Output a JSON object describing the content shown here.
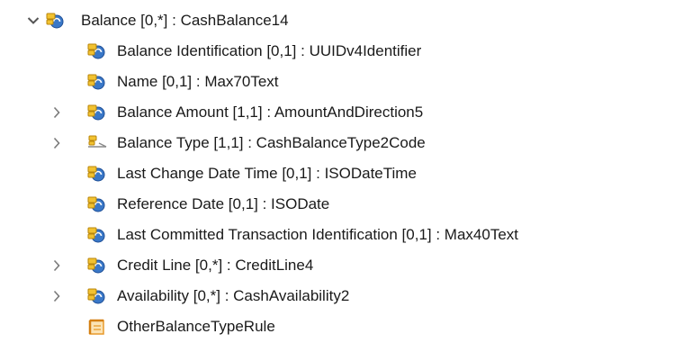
{
  "tree": {
    "root": {
      "label": "Balance [0,*] : CashBalance14",
      "expanded": true,
      "icon": "element-icon"
    },
    "children": [
      {
        "label": "Balance Identification [0,1] : UUIDv4Identifier",
        "icon": "element-icon",
        "expandable": false
      },
      {
        "label": "Name [0,1] : Max70Text",
        "icon": "element-icon",
        "expandable": false
      },
      {
        "label": "Balance Amount [1,1] : AmountAndDirection5",
        "icon": "element-icon",
        "expandable": true
      },
      {
        "label": "Balance Type [1,1] : CashBalanceType2Code",
        "icon": "code-element-icon",
        "expandable": true
      },
      {
        "label": "Last Change Date Time [0,1] : ISODateTime",
        "icon": "element-icon",
        "expandable": false
      },
      {
        "label": "Reference Date [0,1] : ISODate",
        "icon": "element-icon",
        "expandable": false
      },
      {
        "label": "Last Committed Transaction Identification [0,1] : Max40Text",
        "icon": "element-icon",
        "expandable": false
      },
      {
        "label": "Credit Line [0,*] : CreditLine4",
        "icon": "element-icon",
        "expandable": true
      },
      {
        "label": "Availability [0,*] : CashAvailability2",
        "icon": "element-icon",
        "expandable": true
      },
      {
        "label": "OtherBalanceTypeRule",
        "icon": "rule-icon",
        "expandable": false
      }
    ]
  },
  "colors": {
    "element_blue": "#3a78c8",
    "element_blue_dark": "#1f4f96",
    "element_yellow": "#f2c230",
    "element_yellow_dark": "#b8860b",
    "rule_orange": "#e89a2c",
    "twisty_gray": "#6b6b6b"
  }
}
